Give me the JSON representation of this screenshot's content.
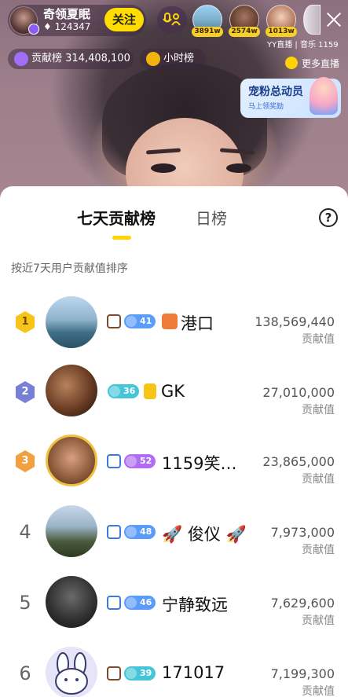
{
  "host": {
    "name": "奇领夏眠",
    "fans": "124347",
    "follow_label": "关注"
  },
  "viewers": [
    {
      "count": "3891w"
    },
    {
      "count": "2574w"
    },
    {
      "count": "1013w"
    }
  ],
  "channel": "YY直播 | 音乐 1159",
  "contribution": {
    "label": "贡献榜 314,408,100"
  },
  "hourly": {
    "label": "小时榜"
  },
  "more_live": {
    "label": "更多直播"
  },
  "promo": {
    "title": "宠粉总动员",
    "subtitle": "马上领奖励"
  },
  "tabs": {
    "seven_day": "七天贡献榜",
    "daily": "日榜",
    "help": "?"
  },
  "subtitle": "按近7天用户贡献值排序",
  "score_label": "贡献值",
  "rows": [
    {
      "rank": "1",
      "level": "41",
      "name": "港口",
      "score": "138,569,440"
    },
    {
      "rank": "2",
      "level": "36",
      "name": "GK",
      "score": "27,010,000"
    },
    {
      "rank": "3",
      "level": "52",
      "name": "1159笑…",
      "score": "23,865,000"
    },
    {
      "rank": "4",
      "level": "48",
      "name": "🚀 俊仪 🚀",
      "score": "7,973,000"
    },
    {
      "rank": "5",
      "level": "46",
      "name": "宁静致远",
      "score": "7,629,600"
    },
    {
      "rank": "6",
      "level": "39",
      "name": "171017",
      "score": "7,199,300"
    }
  ],
  "colors": {
    "accent": "#ffd400",
    "rank1": "#f5c518",
    "rank2": "#7a7fd6",
    "rank3": "#f0a040",
    "level_blue": "#5a9cf8",
    "level_teal": "#44c6d8",
    "level_purple": "#b06cf2"
  }
}
